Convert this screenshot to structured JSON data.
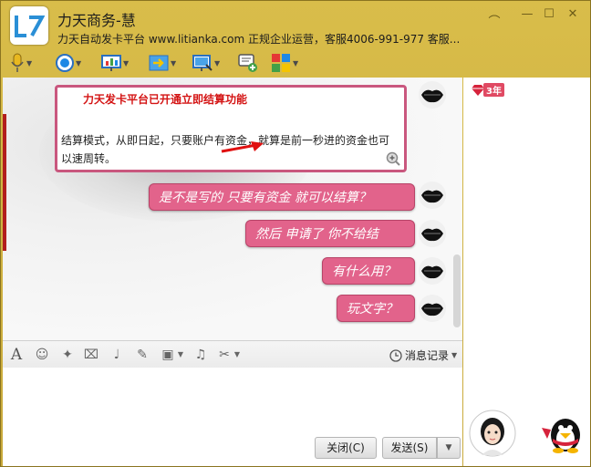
{
  "window": {
    "title": "力天商务-慧",
    "subtitle": "力天自动发卡平台 www.litianka.com 正规企业运营，客服4006-991-977 客服...",
    "minimize_label": "—",
    "maximize_label": "☐",
    "close_label": "✕",
    "extra_label": "︵"
  },
  "toolbar": {
    "items": [
      {
        "icon": "microphone-icon"
      },
      {
        "icon": "video-camera-icon"
      },
      {
        "icon": "screen-share-icon"
      },
      {
        "icon": "transfer-file-icon"
      },
      {
        "icon": "remote-desktop-icon"
      },
      {
        "icon": "add-chat-icon"
      },
      {
        "icon": "apps-grid-icon"
      }
    ]
  },
  "chat": {
    "card": {
      "title": "力天发卡平台已开通立即结算功能",
      "body": "结算模式，从即日起，只要账户有资金，就算是前一秒进的资金也可以速周转。"
    },
    "messages": [
      {
        "text": "是不是写的 只要有资金 就可以结算？"
      },
      {
        "text": "然后 申请了 你不给结"
      },
      {
        "text": "有什么用？"
      },
      {
        "text": "玩文字？"
      }
    ]
  },
  "input_toolbar": {
    "history_label": "消息记录",
    "icons": [
      "font-icon",
      "emoji-icon",
      "magic-wand-icon",
      "screenshot-icon",
      "voice-icon",
      "edit-icon",
      "image-icon",
      "music-icon",
      "scissors-icon"
    ]
  },
  "buttons": {
    "close_label": "关闭(C)",
    "send_label": "发送(S)",
    "send_more_label": "▼"
  },
  "side": {
    "vip_years": "3年"
  },
  "colors": {
    "titlebar": "#c8a93a",
    "bubble": "#e2638b",
    "card_border": "#c9577e",
    "card_title": "#d41414"
  }
}
